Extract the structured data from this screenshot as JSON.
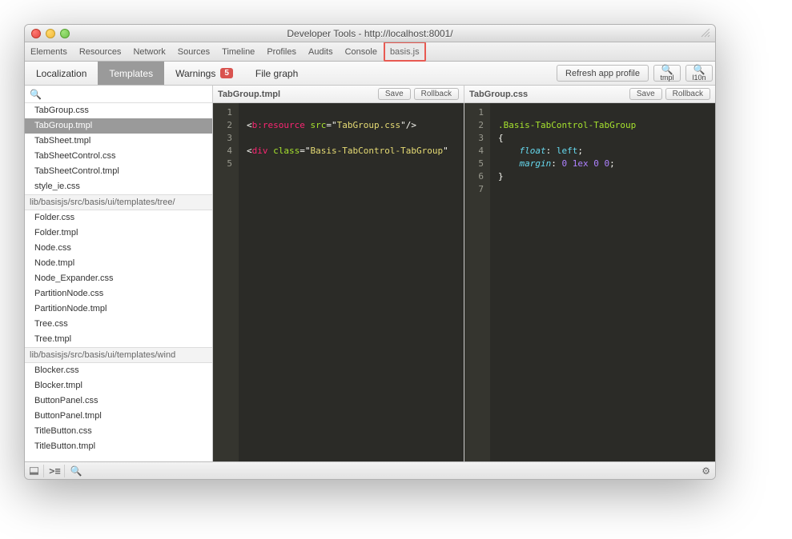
{
  "window": {
    "title": "Developer Tools - http://localhost:8001/"
  },
  "devtabs": [
    "Elements",
    "Resources",
    "Network",
    "Sources",
    "Timeline",
    "Profiles",
    "Audits",
    "Console",
    "basis.js"
  ],
  "devtabs_highlight_index": 8,
  "subtabs": {
    "items": [
      {
        "label": "Localization"
      },
      {
        "label": "Templates",
        "active": true
      },
      {
        "label": "Warnings",
        "badge": "5"
      },
      {
        "label": "File graph"
      }
    ],
    "refresh": "Refresh app profile",
    "search_tmpl": "tmpl",
    "search_l10n": "l10n"
  },
  "search_placeholder": "",
  "files_group1": [
    "TabGroup.css",
    "TabGroup.tmpl",
    "TabSheet.tmpl",
    "TabSheetControl.css",
    "TabSheetControl.tmpl",
    "style_ie.css"
  ],
  "files_selected": "TabGroup.tmpl",
  "group2_header": "lib/basisjs/src/basis/ui/templates/tree/",
  "files_group2": [
    "Folder.css",
    "Folder.tmpl",
    "Node.css",
    "Node.tmpl",
    "Node_Expander.css",
    "PartitionNode.css",
    "PartitionNode.tmpl",
    "Tree.css",
    "Tree.tmpl"
  ],
  "group3_header": "lib/basisjs/src/basis/ui/templates/wind",
  "files_group3": [
    "Blocker.css",
    "Blocker.tmpl",
    "ButtonPanel.css",
    "ButtonPanel.tmpl",
    "TitleButton.css",
    "TitleButton.tmpl"
  ],
  "editor_left": {
    "filename": "TabGroup.tmpl",
    "save": "Save",
    "rollback": "Rollback",
    "lines": [
      "1",
      "2",
      "3",
      "4",
      "5"
    ],
    "code": {
      "l2_open": "<",
      "l2_tag": "b:resource",
      "l2_sp": " ",
      "l2_attr": "src",
      "l2_eq": "=",
      "l2_q": "\"",
      "l2_val": "TabGroup.css",
      "l2_close": "/>",
      "l4_open": "<",
      "l4_tag": "div",
      "l4_sp": " ",
      "l4_attr": "class",
      "l4_eq": "=",
      "l4_q": "\"",
      "l4_val": "Basis-TabControl-TabGroup",
      "l4_end": "\""
    }
  },
  "editor_right": {
    "filename": "TabGroup.css",
    "save": "Save",
    "rollback": "Rollback",
    "lines": [
      "1",
      "2",
      "3",
      "4",
      "5",
      "6",
      "7"
    ],
    "code": {
      "sel": ".Basis-TabControl-TabGroup",
      "ob": "{",
      "p1": "float",
      "v1": "left",
      "semi": ";",
      "p2": "margin",
      "v2a": "0",
      "v2b": "1ex",
      "v2c": "0",
      "v2d": "0",
      "cb": "}"
    }
  }
}
